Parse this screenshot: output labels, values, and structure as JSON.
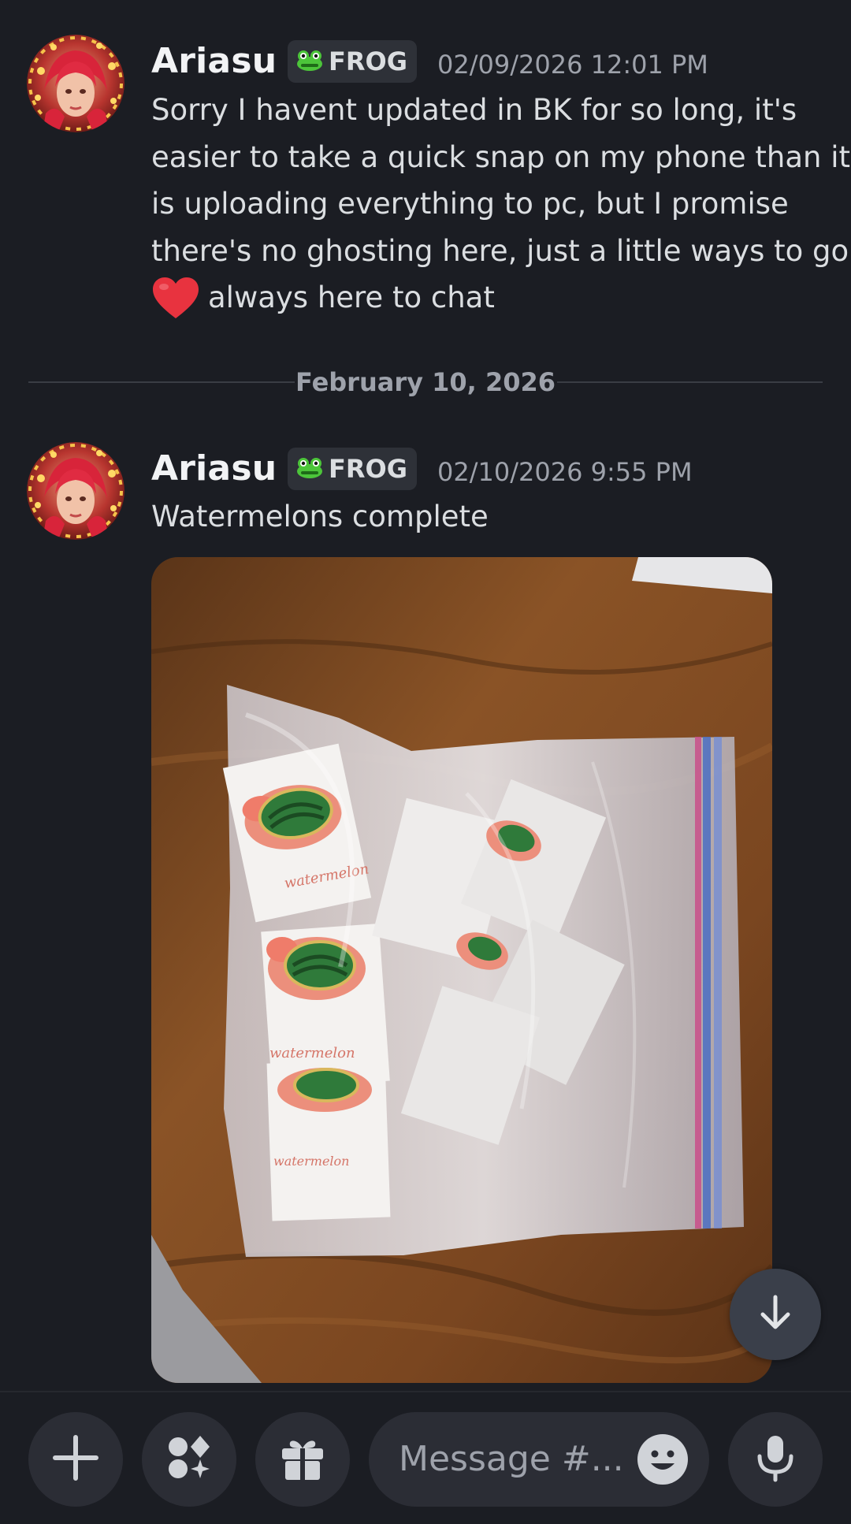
{
  "messages": [
    {
      "username": "Ariasu",
      "tag": "FROG",
      "timestamp": "02/09/2026 12:01 PM",
      "lines": [
        "Sorry I havent updated in BK for so long, it's",
        "easier to take a quick snap on my phone than it",
        "is uploading everything to pc, but I promise",
        "there's no ghosting here, just a little ways to go"
      ],
      "last_line": "always here to chat",
      "emoji": "heart"
    },
    {
      "username": "Ariasu",
      "tag": "FROG",
      "timestamp": "02/10/2026 9:55 PM",
      "text": "Watermelons complete",
      "attachment_card_text": "watermelon"
    }
  ],
  "date_divider": "February 10, 2026",
  "composer": {
    "placeholder": "Message #..."
  },
  "icons": {
    "add": "plus-icon",
    "apps": "apps-icon",
    "gift": "gift-icon",
    "emoji": "emoji-icon",
    "mic": "microphone-icon",
    "scroll": "arrow-down-icon",
    "tag": "frog-icon",
    "heart": "heart-emoji"
  },
  "colors": {
    "background": "#1b1d23",
    "username": "#f2f3f5",
    "text": "#dbdee1",
    "muted": "#9ea2ab",
    "tag_bg": "#2e3138",
    "button_bg": "#2b2d35",
    "heart": "#e8333f"
  }
}
